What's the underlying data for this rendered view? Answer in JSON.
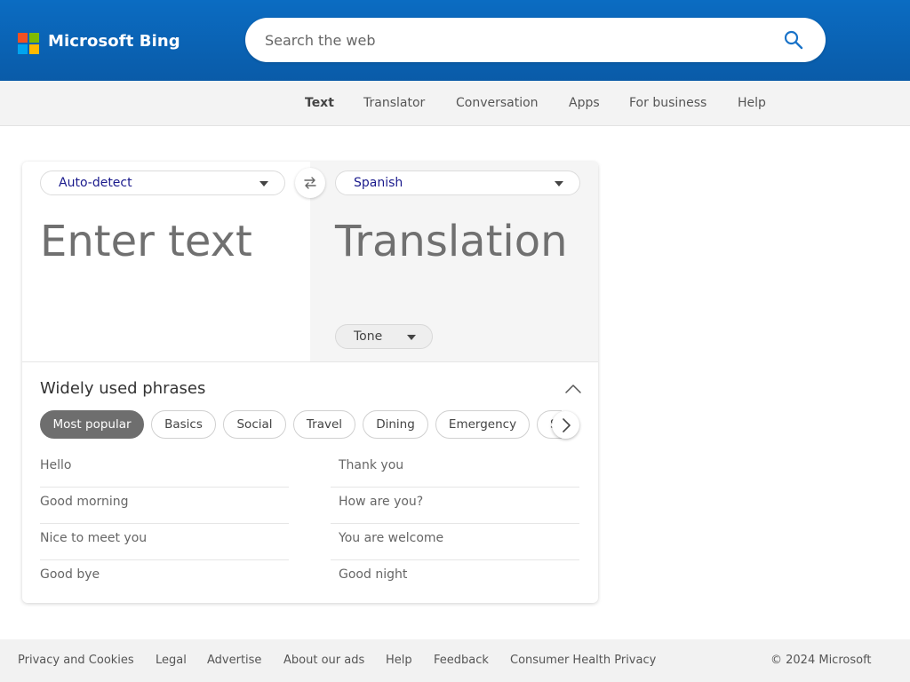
{
  "header": {
    "brand": "Microsoft Bing",
    "search_placeholder": "Search the web",
    "search_value": "",
    "search_icon": "search-icon",
    "logo_colors": [
      "#f25022",
      "#7fba00",
      "#00a4ef",
      "#ffb900"
    ]
  },
  "nav": {
    "items": [
      {
        "label": "Text"
      },
      {
        "label": "Translator"
      },
      {
        "label": "Conversation"
      },
      {
        "label": "Apps"
      },
      {
        "label": "For business"
      },
      {
        "label": "Help"
      }
    ],
    "active": "Text"
  },
  "translator": {
    "source_lang": "Auto-detect",
    "target_lang": "Spanish",
    "swap_icon": "swap-arrows-icon",
    "input_placeholder": "Enter text",
    "output_placeholder": "Translation",
    "tone_label": "Tone"
  },
  "phrases": {
    "title": "Widely used phrases",
    "categories": [
      {
        "label": "Most popular",
        "selected": true
      },
      {
        "label": "Basics"
      },
      {
        "label": "Social"
      },
      {
        "label": "Travel"
      },
      {
        "label": "Dining"
      },
      {
        "label": "Emergency"
      }
    ],
    "partial_category": "S",
    "left": [
      "Hello",
      "Good morning",
      "Nice to meet you",
      "Good bye"
    ],
    "right": [
      "Thank you",
      "How are you?",
      "You are welcome",
      "Good night"
    ]
  },
  "footer": {
    "links": [
      {
        "label": "Privacy and Cookies"
      },
      {
        "label": "Legal"
      },
      {
        "label": "Advertise"
      },
      {
        "label": "About our ads"
      },
      {
        "label": "Help"
      },
      {
        "label": "Feedback"
      },
      {
        "label": "Consumer Health Privacy"
      }
    ],
    "copyright": "© 2024 Microsoft"
  },
  "colors": {
    "header_bg": "#0b6cc2",
    "accent": "#0078d4",
    "selected_chip": "#6e6e6e"
  }
}
